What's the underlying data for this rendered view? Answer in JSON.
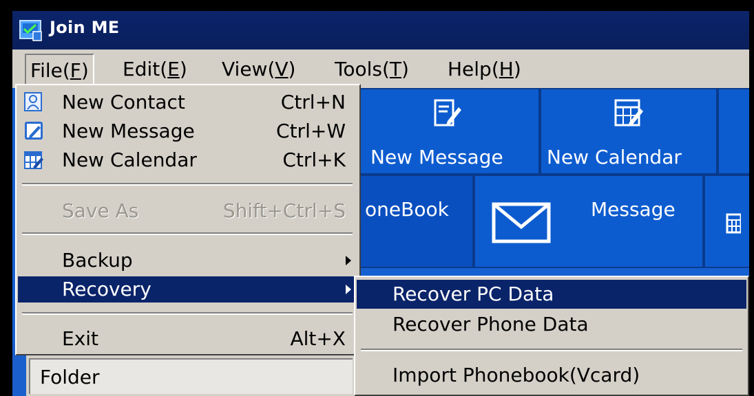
{
  "window": {
    "title": "Join ME",
    "icon": "join-me-app-icon"
  },
  "menubar": {
    "items": [
      {
        "label": "File(F)",
        "mnemonic": "F"
      },
      {
        "label": "Edit(E)",
        "mnemonic": "E"
      },
      {
        "label": "View(V)",
        "mnemonic": "V"
      },
      {
        "label": "Tools(T)",
        "mnemonic": "T"
      },
      {
        "label": "Help(H)",
        "mnemonic": "H"
      }
    ]
  },
  "file_menu": {
    "items": [
      {
        "label": "New Contact",
        "shortcut": "Ctrl+N",
        "icon": "contact-icon"
      },
      {
        "label": "New Message",
        "shortcut": "Ctrl+W",
        "icon": "message-edit-icon"
      },
      {
        "label": "New Calendar",
        "shortcut": "Ctrl+K",
        "icon": "calendar-edit-icon"
      },
      {
        "label": "Save As",
        "shortcut": "Shift+Ctrl+S",
        "disabled": true
      },
      {
        "label": "Backup",
        "submenu": true
      },
      {
        "label": "Recovery",
        "submenu": true,
        "highlighted": true
      },
      {
        "label": "Exit",
        "shortcut": "Alt+X"
      }
    ]
  },
  "recovery_submenu": {
    "items": [
      {
        "label": "Recover PC Data",
        "highlighted": true
      },
      {
        "label": "Recover Phone Data"
      },
      {
        "label": "Import Phonebook(Vcard)"
      }
    ]
  },
  "toolbar": {
    "new_message_label": "New Message",
    "new_calendar_label": "New Calendar"
  },
  "tabs": {
    "phonebook_label": "oneBook",
    "message_label": "Message"
  },
  "sidebar": {
    "folder_label": "Folder"
  },
  "colors": {
    "titlebar": "#0a246a",
    "app_blue": "#1561d2",
    "highlight": "#0a246a",
    "menu_bg": "#d4d0c8"
  }
}
